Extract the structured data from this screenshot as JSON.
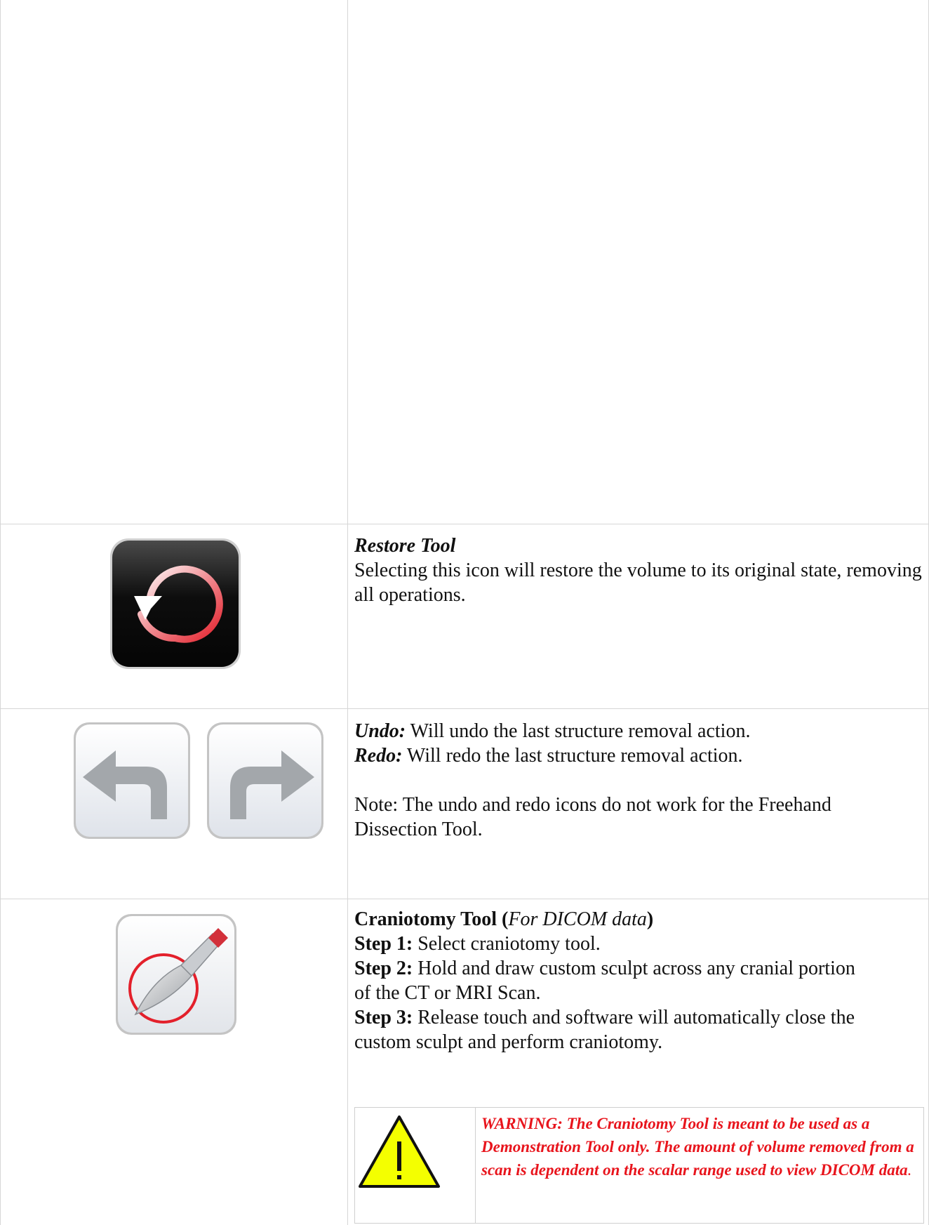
{
  "restore": {
    "title": "Restore Tool",
    "body": "Selecting this icon will restore the volume to its original state, removing all operations."
  },
  "undo_redo": {
    "undo_label": "Undo:",
    "undo_text": " Will undo the last structure removal action.",
    "redo_label": "Redo:",
    "redo_text": " Will redo the last structure removal action.",
    "note": "Note: The undo and redo icons do not work for the Freehand Dissection Tool."
  },
  "craniotomy": {
    "title_bold": "Craniotomy Tool (",
    "title_italic": "For DICOM data",
    "title_close": ")",
    "steps": [
      {
        "label": "Step 1:",
        "text": " Select craniotomy tool."
      },
      {
        "label": "Step 2:",
        "text": " Hold and draw custom sculpt across any cranial portion of the CT or MRI Scan."
      },
      {
        "label": "Step 3:",
        "text": " Release touch and software will automatically close the custom sculpt and perform craniotomy."
      }
    ],
    "warning": "WARNING: The Craniotomy Tool is meant to be used as a Demonstration Tool only.  The amount of volume removed from a scan is dependent on the scalar range used to view DICOM data",
    "warning_end": "."
  },
  "colors": {
    "warning_red": "#e8141c",
    "warning_yellow": "#f4ff00",
    "border": "#d6d6d6"
  },
  "icons": [
    "restore-icon",
    "undo-icon",
    "redo-icon",
    "scalpel-icon",
    "warning-triangle-icon"
  ]
}
